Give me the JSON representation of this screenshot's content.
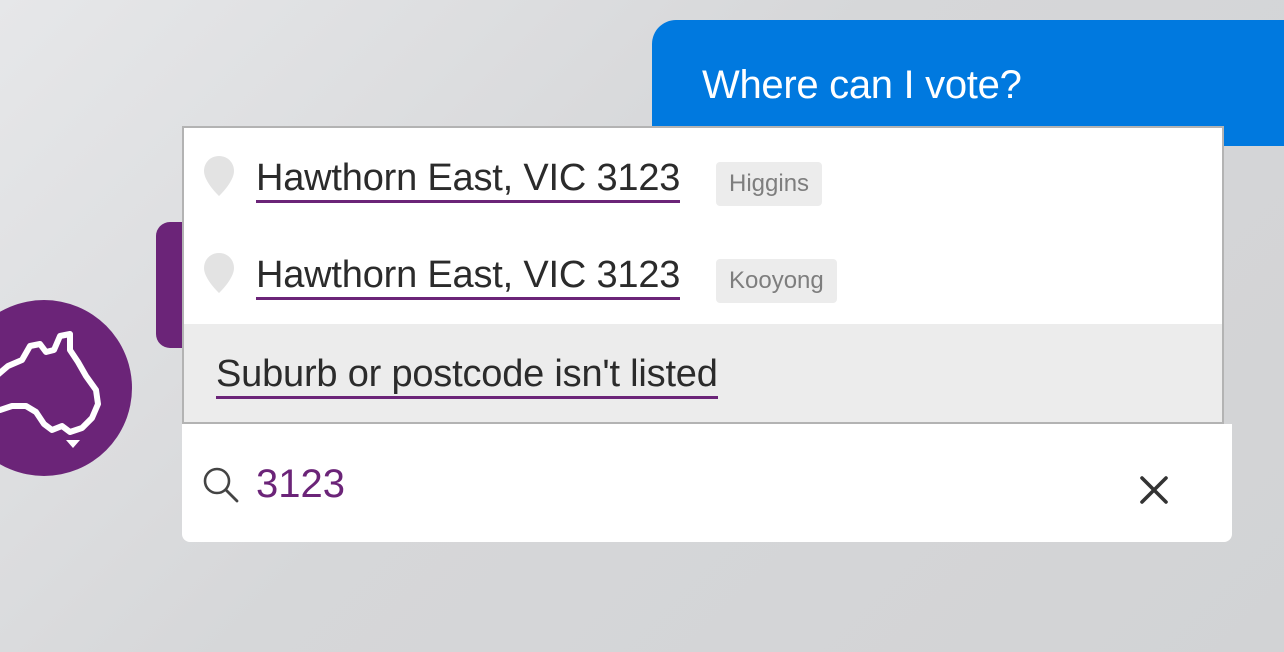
{
  "user_message": {
    "text": "Where can I vote?",
    "color": "#0079df"
  },
  "brand_color": "#6b2478",
  "avatar": {
    "icon": "australia-map-icon"
  },
  "suggestions": [
    {
      "label": "Hawthorn East, VIC 3123",
      "tag": "Higgins",
      "icon": "map-pin-icon"
    },
    {
      "label": "Hawthorn East, VIC 3123",
      "tag": "Kooyong",
      "icon": "map-pin-icon"
    }
  ],
  "unlisted_option": {
    "label": "Suburb or postcode isn't listed"
  },
  "search": {
    "value": "3123",
    "icon": "search-icon",
    "clear_icon": "close-icon"
  }
}
